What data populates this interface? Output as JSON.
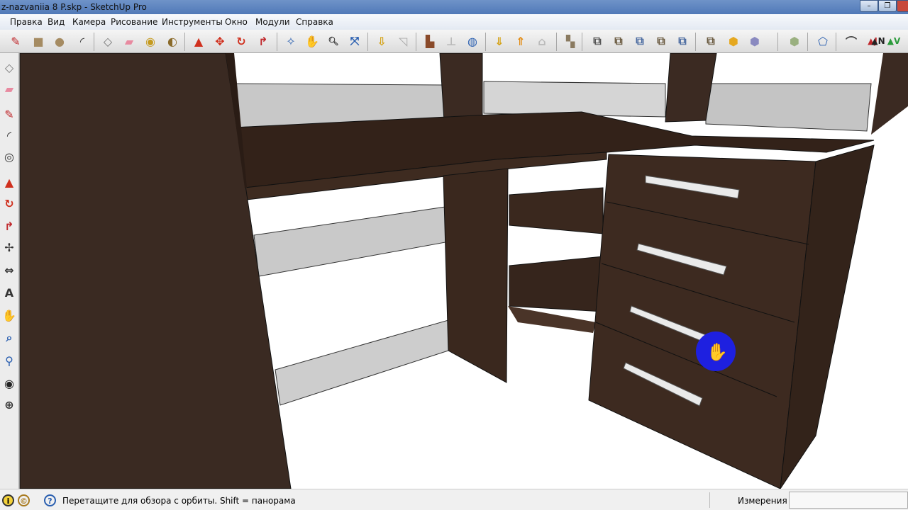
{
  "window": {
    "title": "z-nazvaniia 8 P.skp - SketchUp Pro",
    "minimize": "–",
    "restore": "❐"
  },
  "menu": [
    "Правка",
    "Вид",
    "Камера",
    "Рисование",
    "Инструменты",
    "Окно",
    "Модули",
    "Справка"
  ],
  "toolbar": [
    {
      "name": "pencil-icon",
      "glyph": "✎",
      "color": "#c0282c"
    },
    {
      "name": "rectangle-icon",
      "glyph": "■",
      "color": "#a58b62"
    },
    {
      "name": "circle-icon",
      "glyph": "●",
      "color": "#a58b62"
    },
    {
      "name": "arc-icon",
      "glyph": "◜",
      "color": "#333"
    },
    {
      "name": "make-component-icon",
      "glyph": "◇",
      "color": "#777"
    },
    {
      "name": "eraser-icon",
      "glyph": "▰",
      "color": "#e88aa0"
    },
    {
      "name": "tape-measure-icon",
      "glyph": "◉",
      "color": "#c59a1e"
    },
    {
      "name": "paint-bucket-icon",
      "glyph": "◐",
      "color": "#8a6a2a"
    },
    {
      "name": "push-pull-icon",
      "glyph": "▲",
      "color": "#d0301e"
    },
    {
      "name": "move-icon",
      "glyph": "✥",
      "color": "#d0301e"
    },
    {
      "name": "rotate-icon",
      "glyph": "↻",
      "color": "#d0301e"
    },
    {
      "name": "follow-me-icon",
      "glyph": "↱",
      "color": "#c0282c"
    },
    {
      "name": "orbit-icon",
      "glyph": "✧",
      "color": "#2a5fb0"
    },
    {
      "name": "pan-icon",
      "glyph": "✋",
      "color": "#555"
    },
    {
      "name": "zoom-icon",
      "glyph": "🔍︎",
      "color": "#333"
    },
    {
      "name": "zoom-extents-icon",
      "glyph": "⤧",
      "color": "#2a5fb0"
    },
    {
      "name": "get-models-icon",
      "glyph": "⇩",
      "color": "#d4a010"
    },
    {
      "name": "share-model-icon",
      "glyph": "◹",
      "color": "#aaa"
    },
    {
      "name": "photo-textures-icon",
      "glyph": "▙",
      "color": "#8a4a2a"
    },
    {
      "name": "toggle-terrain-icon",
      "glyph": "⊥",
      "color": "#bbb"
    },
    {
      "name": "google-earth-icon",
      "glyph": "◍",
      "color": "#2a5fb0"
    },
    {
      "name": "get-current-view-icon",
      "glyph": "⇓",
      "color": "#d4a010"
    },
    {
      "name": "share-component-icon",
      "glyph": "⇑",
      "color": "#e38a10"
    },
    {
      "name": "warehouse-icon",
      "glyph": "⌂",
      "color": "#bbb"
    },
    {
      "name": "outliner-icon",
      "glyph": "▚",
      "color": "#8a7a60"
    },
    {
      "name": "outer-shell-icon",
      "glyph": "⧉",
      "color": "#555"
    },
    {
      "name": "intersect-icon",
      "glyph": "⧉",
      "color": "#6a5a40"
    },
    {
      "name": "union-icon",
      "glyph": "⧉",
      "color": "#4a6aa0"
    },
    {
      "name": "subtract-icon",
      "glyph": "⧉",
      "color": "#6a5a40"
    },
    {
      "name": "trim-icon",
      "glyph": "⧉",
      "color": "#4a6aa0"
    },
    {
      "name": "split-icon",
      "glyph": "⧉",
      "color": "#6a5a40"
    },
    {
      "name": "iso-view-icon",
      "glyph": "⬢",
      "color": "#e5a820"
    },
    {
      "name": "top-view-icon",
      "glyph": "⬢",
      "color": "#8a8ac0"
    },
    {
      "name": "front-view-icon",
      "glyph": "⬢",
      "color": "#9ab080"
    },
    {
      "name": "section-plane-icon",
      "glyph": "⬠",
      "color": "#2a5fb0"
    },
    {
      "name": "bend-icon",
      "glyph": "⌒",
      "color": "#444"
    },
    {
      "name": "push-pull-j-icon",
      "glyph": "▲J",
      "color": "#c0282c"
    },
    {
      "name": "push-pull-v-icon",
      "glyph": "▲V",
      "color": "#2a9a3a"
    },
    {
      "name": "push-pull-n-icon",
      "glyph": "▲N",
      "color": "#222"
    }
  ],
  "left_toolbar": [
    {
      "name": "select-icon",
      "glyph": "◇",
      "color": "#777"
    },
    {
      "name": "eraser-icon",
      "glyph": "▰",
      "color": "#e88aa0"
    },
    {
      "name": "pencil-icon",
      "glyph": "✎",
      "color": "#c0282c"
    },
    {
      "name": "arc-icon",
      "glyph": "◜",
      "color": "#333"
    },
    {
      "name": "offset-icon",
      "glyph": "◎",
      "color": "#333"
    },
    {
      "name": "push-pull-icon",
      "glyph": "▲",
      "color": "#d0301e"
    },
    {
      "name": "rotate-icon",
      "glyph": "↻",
      "color": "#d0301e"
    },
    {
      "name": "follow-me-icon",
      "glyph": "↱",
      "color": "#c0282c"
    },
    {
      "name": "axes-icon",
      "glyph": "✢",
      "color": "#333"
    },
    {
      "name": "dimension-icon",
      "glyph": "⇔",
      "color": "#333"
    },
    {
      "name": "3d-text-icon",
      "glyph": "A",
      "color": "#333"
    },
    {
      "name": "pan-icon",
      "glyph": "✋",
      "color": "#555"
    },
    {
      "name": "zoom-window-icon",
      "glyph": "⌕",
      "color": "#2a5fb0"
    },
    {
      "name": "position-camera-icon",
      "glyph": "⚲",
      "color": "#2a5fb0"
    },
    {
      "name": "look-around-icon",
      "glyph": "◉",
      "color": "#222"
    },
    {
      "name": "walk-icon",
      "glyph": "⊕",
      "color": "#333"
    }
  ],
  "status": {
    "message": "Перетащите для обзора с орбиты.  Shift = панорама",
    "measurements_label": "Измерения",
    "measurements_value": "",
    "info_icon": "i",
    "credits_icon": "©",
    "help_icon": "?"
  }
}
